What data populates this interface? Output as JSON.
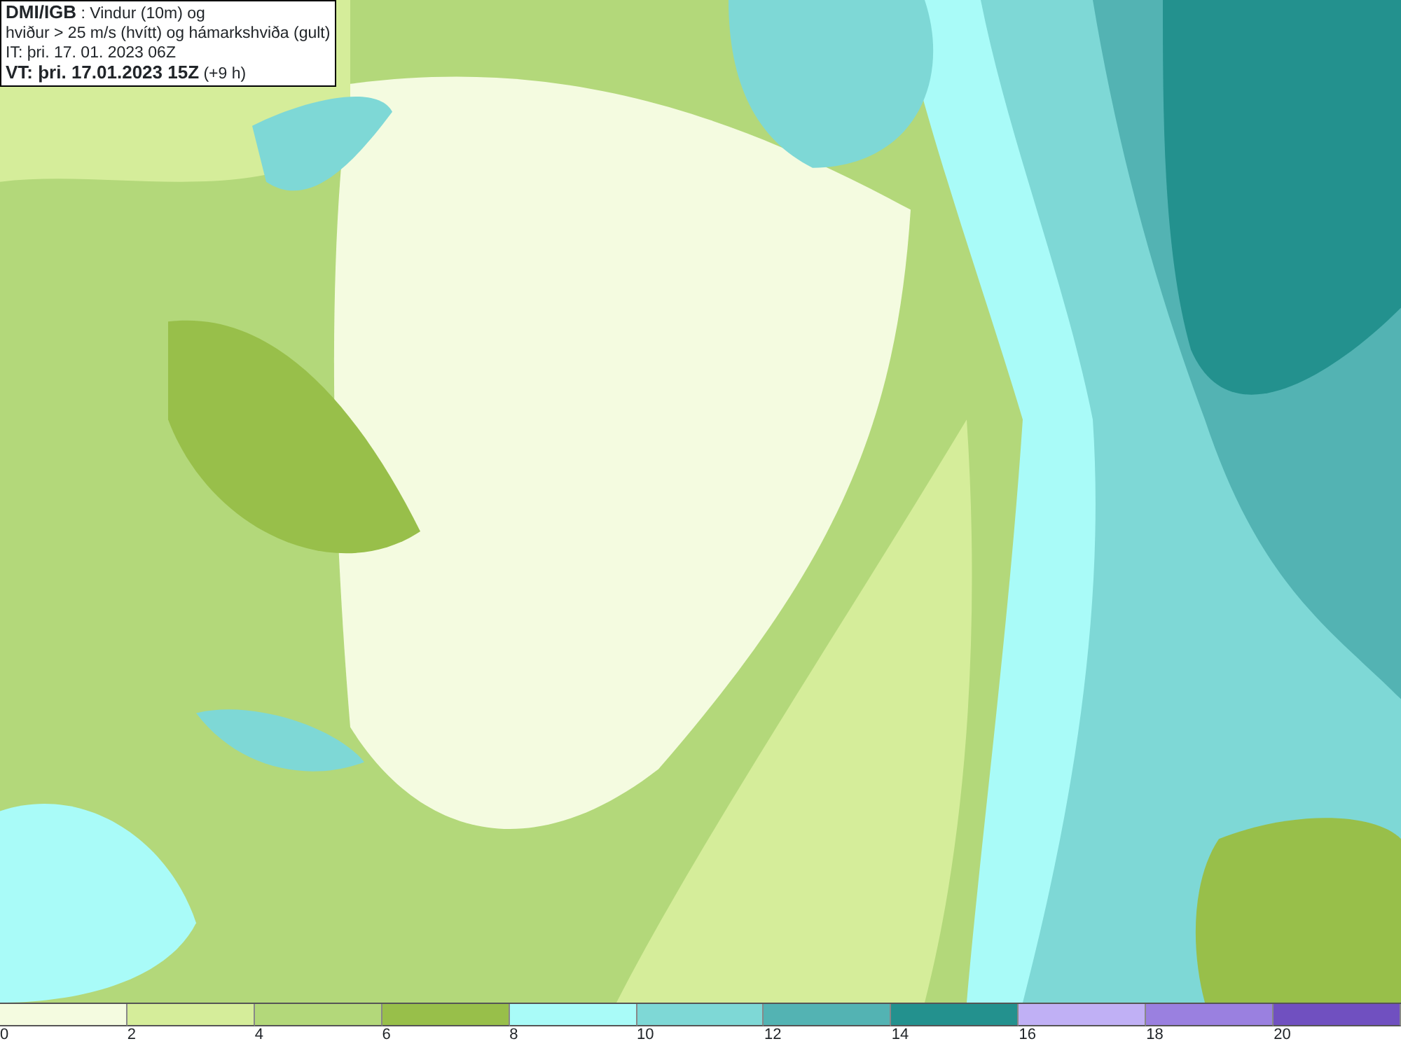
{
  "title_box": {
    "lines": [
      "**DMI/IGB** : Vindur (10m) og",
      "hviður > 25 m/s (hvítt) og hámarkshviða (gult)",
      "IT: þri. 17. 01. 2023 06Z",
      "**VT: þri. 17.01.2023 15Z** (+9 h)"
    ]
  },
  "legend": [
    {
      "color": "#f4fbe0",
      "label": "0"
    },
    {
      "color": "#d5ed9a",
      "label": "2"
    },
    {
      "color": "#b3d87a",
      "label": "4"
    },
    {
      "color": "#98bf4a",
      "label": "6"
    },
    {
      "color": "#a9fbf8",
      "label": "8"
    },
    {
      "color": "#7ed8d6",
      "label": "10"
    },
    {
      "color": "#53b3b3",
      "label": "12"
    },
    {
      "color": "#23918e",
      "label": "14"
    },
    {
      "color": "#c0b0f5",
      "label": "16"
    },
    {
      "color": "#9a80e0",
      "label": "18"
    },
    {
      "color": "#7050c0",
      "label": "20"
    }
  ]
}
